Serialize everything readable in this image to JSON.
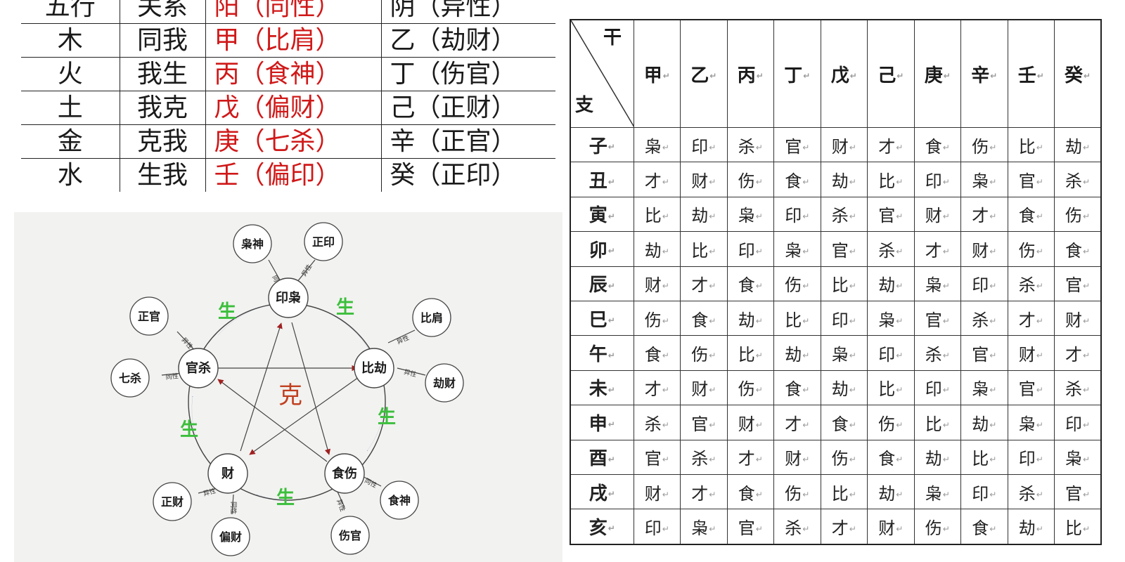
{
  "five_elements_table": {
    "header": [
      "五行",
      "关系",
      "阳（同性）",
      "阴（异性）"
    ],
    "rows": [
      [
        "木",
        "同我",
        "甲（比肩）",
        "乙（劫财）"
      ],
      [
        "火",
        "我生",
        "丙（食神）",
        "丁（伤官）"
      ],
      [
        "土",
        "我克",
        "戊（偏财）",
        "己（正财）"
      ],
      [
        "金",
        "克我",
        "庚（七杀）",
        "辛（正官）"
      ],
      [
        "水",
        "生我",
        "壬（偏印）",
        "癸（正印）"
      ]
    ],
    "yang_color": "#d01818"
  },
  "diagram": {
    "center_label": "克",
    "generate_label": "生",
    "nodes": {
      "yin_xiao": "印枭",
      "bi_jie": "比劫",
      "shi_shang": "食伤",
      "cai": "财",
      "guan_sha": "官杀"
    },
    "satellites": {
      "xiao_shen": "枭神",
      "zheng_yin": "正印",
      "bi_jian": "比肩",
      "jie_cai": "劫财",
      "shi_shen": "食神",
      "shang_guan": "伤官",
      "zheng_cai": "正财",
      "pian_cai": "偏财",
      "qi_sha": "七杀",
      "zheng_guan": "正官"
    },
    "link_labels": {
      "same": "同性",
      "diff": "异性"
    },
    "colors": {
      "generate_arrow": "#1f3f9f",
      "restrain_arrow": "#a02020",
      "generate_text": "#3cbf3c",
      "center_text": "#c04020",
      "background": "#f2f2f0"
    }
  },
  "ten_gods_table": {
    "corner_top": "干",
    "corner_bottom": "支",
    "stems": [
      "甲",
      "乙",
      "丙",
      "丁",
      "戊",
      "己",
      "庚",
      "辛",
      "壬",
      "癸"
    ],
    "rows": [
      {
        "branch": "子",
        "cells": [
          "枭",
          "印",
          "杀",
          "官",
          "财",
          "才",
          "食",
          "伤",
          "比",
          "劫"
        ]
      },
      {
        "branch": "丑",
        "cells": [
          "才",
          "财",
          "伤",
          "食",
          "劫",
          "比",
          "印",
          "枭",
          "官",
          "杀"
        ]
      },
      {
        "branch": "寅",
        "cells": [
          "比",
          "劫",
          "枭",
          "印",
          "杀",
          "官",
          "财",
          "才",
          "食",
          "伤"
        ]
      },
      {
        "branch": "卯",
        "cells": [
          "劫",
          "比",
          "印",
          "枭",
          "官",
          "杀",
          "才",
          "财",
          "伤",
          "食"
        ]
      },
      {
        "branch": "辰",
        "cells": [
          "财",
          "才",
          "食",
          "伤",
          "比",
          "劫",
          "枭",
          "印",
          "杀",
          "官"
        ]
      },
      {
        "branch": "巳",
        "cells": [
          "伤",
          "食",
          "劫",
          "比",
          "印",
          "枭",
          "官",
          "杀",
          "才",
          "财"
        ]
      },
      {
        "branch": "午",
        "cells": [
          "食",
          "伤",
          "比",
          "劫",
          "枭",
          "印",
          "杀",
          "官",
          "财",
          "才"
        ]
      },
      {
        "branch": "未",
        "cells": [
          "才",
          "财",
          "伤",
          "食",
          "劫",
          "比",
          "印",
          "枭",
          "官",
          "杀"
        ]
      },
      {
        "branch": "申",
        "cells": [
          "杀",
          "官",
          "财",
          "才",
          "食",
          "伤",
          "比",
          "劫",
          "枭",
          "印"
        ]
      },
      {
        "branch": "酉",
        "cells": [
          "官",
          "杀",
          "才",
          "财",
          "伤",
          "食",
          "劫",
          "比",
          "印",
          "枭"
        ]
      },
      {
        "branch": "戌",
        "cells": [
          "财",
          "才",
          "食",
          "伤",
          "比",
          "劫",
          "枭",
          "印",
          "杀",
          "官"
        ]
      },
      {
        "branch": "亥",
        "cells": [
          "印",
          "枭",
          "官",
          "杀",
          "才",
          "财",
          "伤",
          "食",
          "劫",
          "比"
        ]
      }
    ]
  }
}
